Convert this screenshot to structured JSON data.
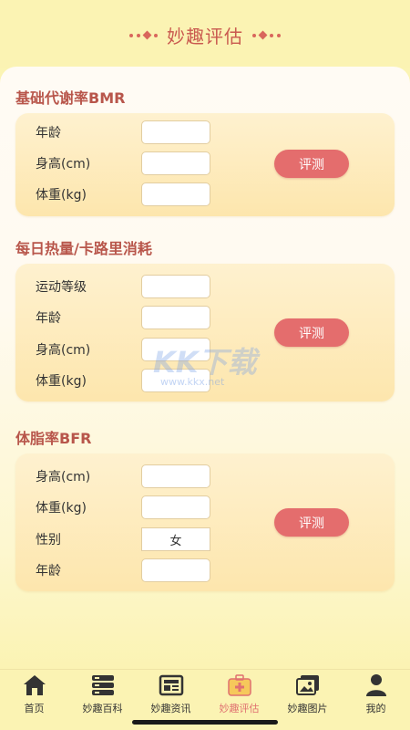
{
  "header": {
    "title": "妙趣评估"
  },
  "sections": [
    {
      "title": "基础代谢率BMR",
      "fields": [
        {
          "label": "年龄",
          "value": ""
        },
        {
          "label": "身高(cm)",
          "value": ""
        },
        {
          "label": "体重(kg)",
          "value": ""
        }
      ],
      "button": "评测"
    },
    {
      "title": "每日热量/卡路里消耗",
      "fields": [
        {
          "label": "运动等级",
          "value": ""
        },
        {
          "label": "年龄",
          "value": ""
        },
        {
          "label": "身高(cm)",
          "value": ""
        },
        {
          "label": "体重(kg)",
          "value": ""
        }
      ],
      "button": "评测"
    },
    {
      "title": "体脂率BFR",
      "fields": [
        {
          "label": "身高(cm)",
          "value": ""
        },
        {
          "label": "体重(kg)",
          "value": ""
        },
        {
          "label": "性别",
          "value": "女"
        },
        {
          "label": "年龄",
          "value": ""
        }
      ],
      "button": "评测"
    }
  ],
  "watermark": {
    "main": "KK下载",
    "sub": "www.kkx.net"
  },
  "tabbar": {
    "active_color": "#e07070",
    "items": [
      {
        "label": "首页",
        "icon": "home-icon"
      },
      {
        "label": "妙趣百科",
        "icon": "database-icon"
      },
      {
        "label": "妙趣资讯",
        "icon": "news-icon"
      },
      {
        "label": "妙趣评估",
        "icon": "medical-kit-icon",
        "active": true
      },
      {
        "label": "妙趣图片",
        "icon": "gallery-icon"
      },
      {
        "label": "我的",
        "icon": "user-icon"
      }
    ]
  }
}
